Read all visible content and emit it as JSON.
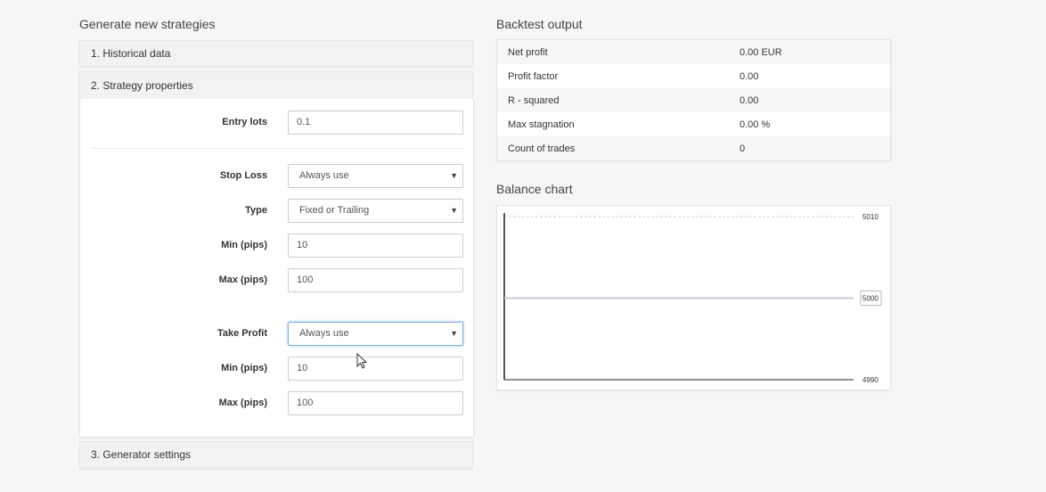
{
  "left": {
    "title": "Generate new strategies",
    "panels": [
      {
        "label": "1. Historical data"
      },
      {
        "label": "2. Strategy properties"
      },
      {
        "label": "3. Generator settings"
      }
    ],
    "form": {
      "entry_lots": {
        "label": "Entry lots",
        "value": "0.1"
      },
      "stop_loss": {
        "label": "Stop Loss",
        "value": "Always use"
      },
      "sl_type": {
        "label": "Type",
        "value": "Fixed or Trailing"
      },
      "sl_min": {
        "label": "Min (pips)",
        "value": "10"
      },
      "sl_max": {
        "label": "Max (pips)",
        "value": "100"
      },
      "take_profit": {
        "label": "Take Profit",
        "value": "Always use"
      },
      "tp_min": {
        "label": "Min (pips)",
        "value": "10"
      },
      "tp_max": {
        "label": "Max (pips)",
        "value": "100"
      }
    },
    "caret": "▼"
  },
  "right": {
    "backtest_title": "Backtest output",
    "stats": [
      {
        "label": "Net profit",
        "value": "0.00 EUR"
      },
      {
        "label": "Profit factor",
        "value": "0.00"
      },
      {
        "label": "R - squared",
        "value": "0.00"
      },
      {
        "label": "Max stagnation",
        "value": "0.00 %"
      },
      {
        "label": "Count of trades",
        "value": "0"
      }
    ],
    "chart_title": "Balance chart"
  },
  "chart_data": {
    "type": "line",
    "title": "Balance chart",
    "xlabel": "",
    "ylabel": "",
    "ylim": [
      4990,
      5010
    ],
    "y_ticks": [
      "5010",
      "4990"
    ],
    "current_label": "5000",
    "series": [
      {
        "name": "Balance",
        "values": [
          5000,
          5000
        ]
      }
    ],
    "grid": false,
    "colors": {
      "balance": "#c8c8dc",
      "axis": "#222222"
    }
  }
}
